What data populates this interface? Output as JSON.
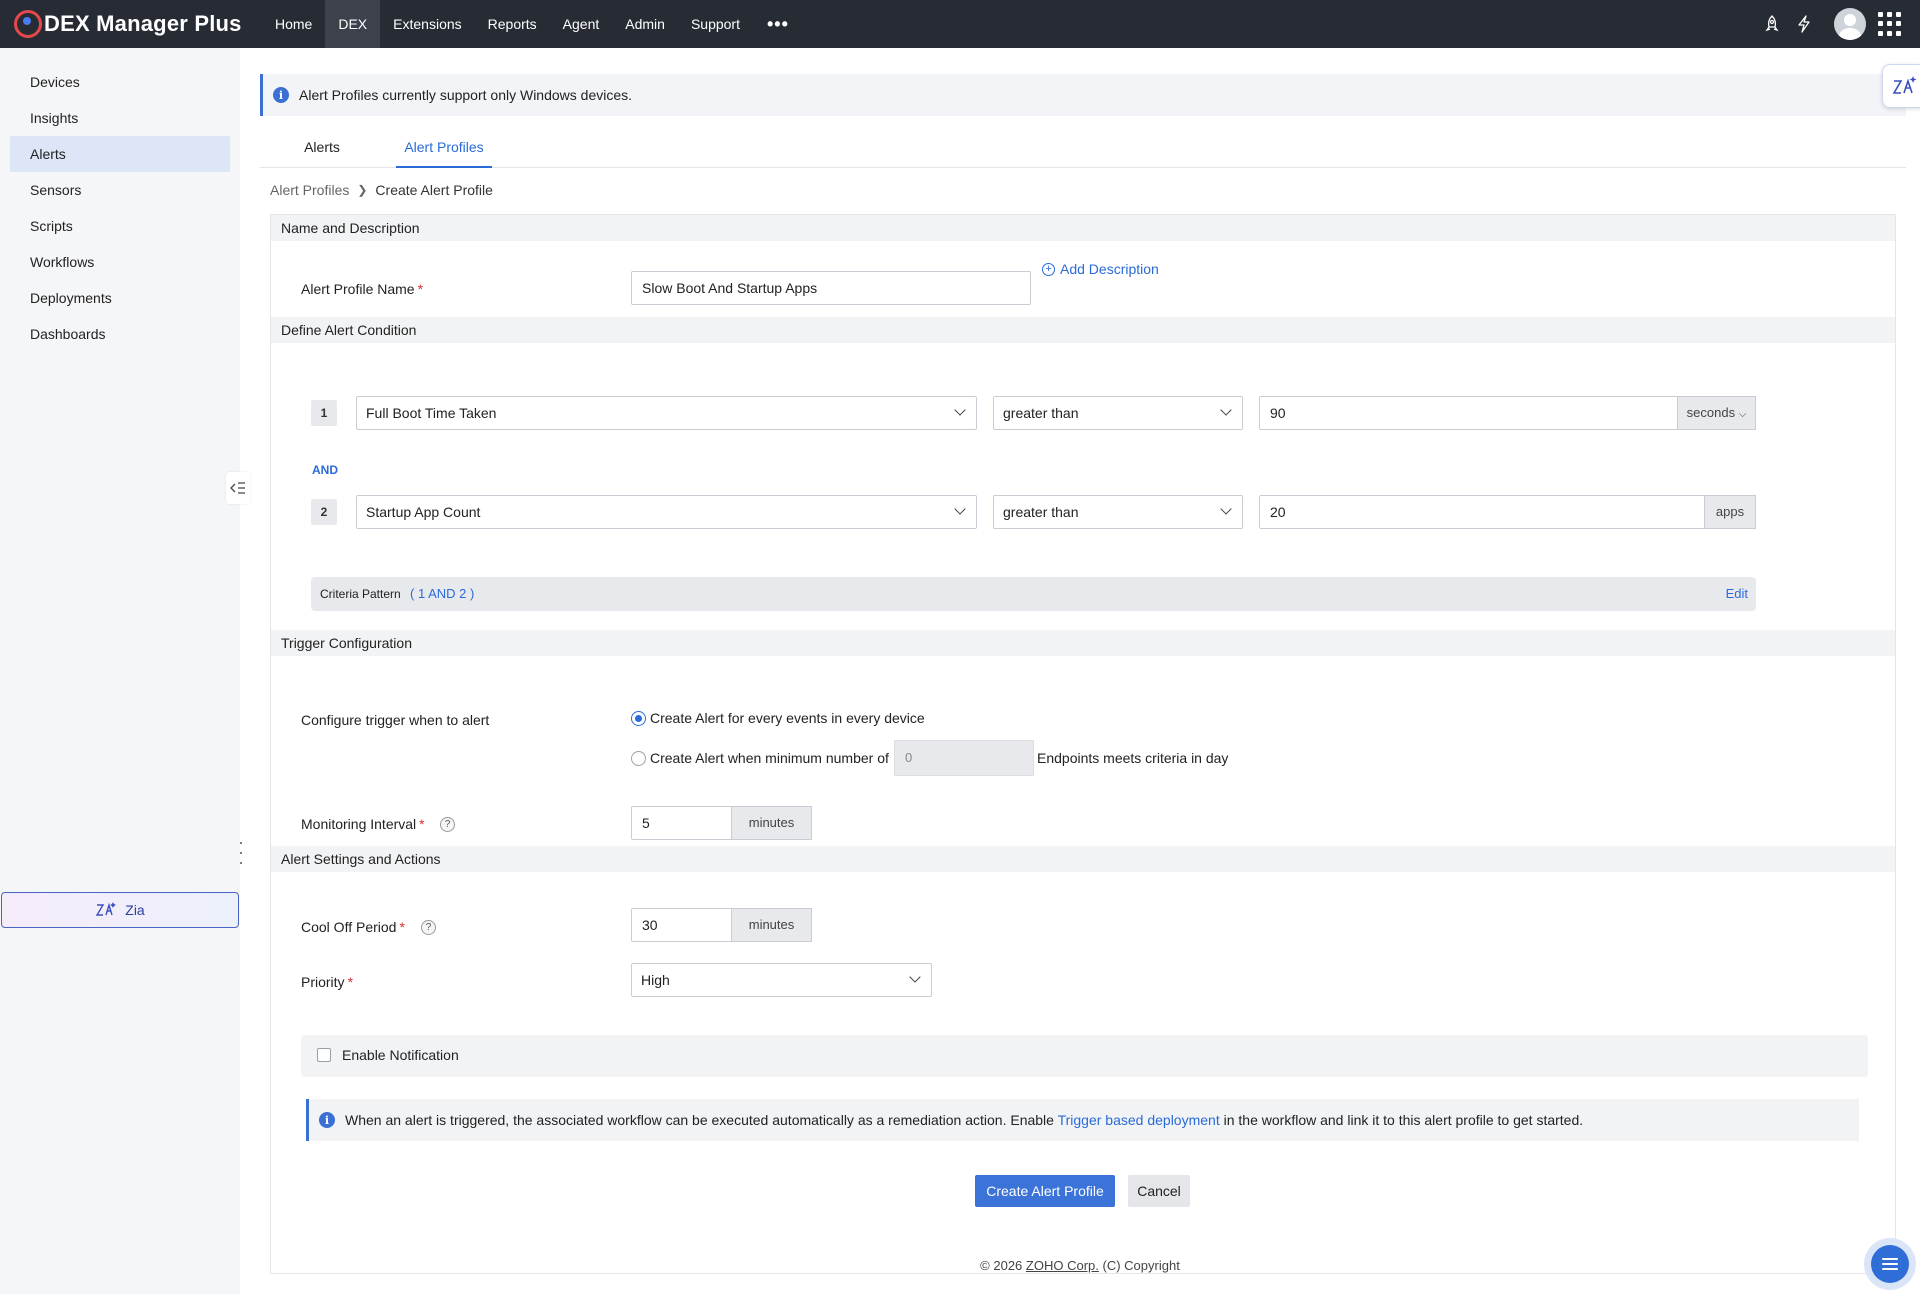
{
  "app": {
    "name": "DEX Manager Plus"
  },
  "nav": {
    "items": [
      "Home",
      "DEX",
      "Extensions",
      "Reports",
      "Agent",
      "Admin",
      "Support"
    ],
    "active": "DEX"
  },
  "sidebar": {
    "items": [
      "Devices",
      "Insights",
      "Alerts",
      "Sensors",
      "Scripts",
      "Workflows",
      "Deployments",
      "Dashboards"
    ],
    "active": "Alerts",
    "zia_label": "Zia"
  },
  "banner": {
    "text": "Alert Profiles currently support only Windows devices."
  },
  "tabs": [
    {
      "label": "Alerts",
      "active": false
    },
    {
      "label": "Alert Profiles",
      "active": true
    }
  ],
  "breadcrumb": {
    "parent": "Alert Profiles",
    "current": "Create Alert Profile"
  },
  "sections": {
    "name": "Name and Description",
    "condition": "Define Alert Condition",
    "trigger": "Trigger Configuration",
    "settings": "Alert Settings and Actions"
  },
  "name_section": {
    "label": "Alert Profile Name",
    "value": "Slow Boot And Startup Apps",
    "add_description": "Add Description"
  },
  "conditions": [
    {
      "num": "1",
      "metric": "Full Boot Time Taken",
      "operator": "greater than",
      "value": "90",
      "unit": "seconds"
    },
    {
      "num": "2",
      "metric": "Startup App Count",
      "operator": "greater than",
      "value": "20",
      "unit": "apps"
    }
  ],
  "and_label": "AND",
  "criteria": {
    "label": "Criteria Pattern",
    "pattern": "( 1 AND 2 )",
    "edit": "Edit"
  },
  "trigger": {
    "label": "Configure trigger when to alert",
    "option1": "Create Alert for every events in every device",
    "option2_prefix": "Create Alert when minimum number of",
    "option2_value": "0",
    "option2_suffix": "Endpoints meets criteria in day",
    "selected": 1
  },
  "monitoring": {
    "label": "Monitoring Interval",
    "value": "5",
    "unit": "minutes"
  },
  "cooloff": {
    "label": "Cool Off Period",
    "value": "30",
    "unit": "minutes"
  },
  "priority": {
    "label": "Priority",
    "value": "High"
  },
  "notification": {
    "label": "Enable Notification",
    "checked": false
  },
  "workflow_banner": {
    "prefix": "When an alert is triggered, the associated workflow can be executed automatically as a remediation action. Enable",
    "link": "Trigger based deployment",
    "suffix": "in the workflow and link it to this alert profile to get started."
  },
  "buttons": {
    "create": "Create Alert Profile",
    "cancel": "Cancel"
  },
  "footer": {
    "prefix": "© 2026",
    "corp": "ZOHO Corp.",
    "suffix": "(C) Copyright"
  },
  "colors": {
    "topbar": "#272b34",
    "accent": "#2a6bd8",
    "primary_button": "#3b73d8"
  }
}
